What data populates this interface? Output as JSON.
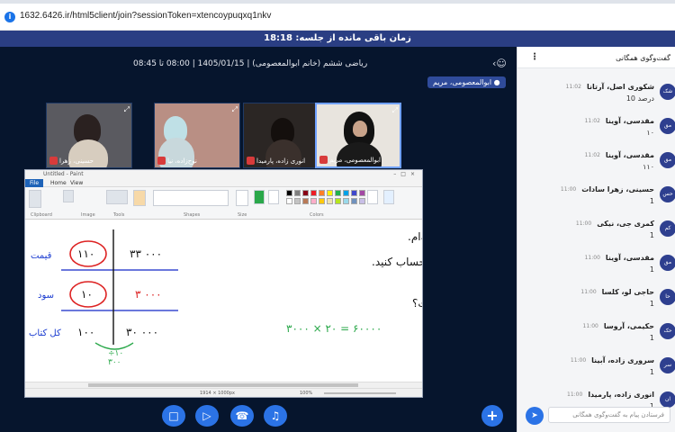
{
  "browser": {
    "url": "1632.6426.ir/html5client/join?sessionToken=xtencoypuqxq1nkv"
  },
  "session": {
    "timer_text": "زمان باقی مانده از جلسه: 18:18"
  },
  "meeting": {
    "title": "ریاضی ششم (خانم ابوالمعصومی) | 1405/01/15 | 08:00 تا 08:45",
    "presenter": "ابوالمعصومی، مریم"
  },
  "videos": [
    {
      "name": "حسینی، زهرا",
      "bg": "#5a5a60",
      "active": false
    },
    {
      "name": "نوح‌زاده، نیا",
      "bg": "#b98f84",
      "active": false
    },
    {
      "name": "انوری زاده، پارمیدا",
      "bg": "#2b2624",
      "active": false
    },
    {
      "name": "ابوالمعصومی، مریم",
      "bg": "#e8e4de",
      "active": true
    }
  ],
  "paint": {
    "window_title": "Untitled - Paint",
    "tabs": [
      "File",
      "Home",
      "View"
    ],
    "ribbon_groups": [
      "Clipboard",
      "Image",
      "Tools",
      "Shapes",
      "Size",
      "Colors"
    ],
    "status_dims": "1914 × 1000px",
    "zoom": "100%",
    "palette": [
      "#000000",
      "#7f7f7f",
      "#880015",
      "#ed1c24",
      "#ff7f27",
      "#fff200",
      "#22b14c",
      "#00a2e8",
      "#3f48cc",
      "#a349a4",
      "#ffffff",
      "#c3c3c3",
      "#b97a57",
      "#ffaec9",
      "#ffc90e",
      "#efe4b0",
      "#b5e61d",
      "#99d9ea",
      "#7092be",
      "#c8bfe7"
    ]
  },
  "board": {
    "problem_line": "۲. کتابی را که ۳۰۰۰ تومان خریداری شده است، ۳۳۰۰ تومان فروخته‌ام.",
    "part_a": "الف) درصد سود این کتاب را حساب کنید.",
    "part_b": "ب) سود ۲۰ عدد کتاب چقدر است؟",
    "answer": "۳۰۰۰ × ۲۰ = ۶۰۰۰۰",
    "label_price": "قیمت",
    "label_profit": "سود",
    "label_total": "کل کتاب",
    "val_110": "۱۱۰",
    "val_10": "۱۰",
    "val_100": "۱۰۰",
    "val_33000": "۳۳ ۰۰۰",
    "val_3000": "۳ ۰۰۰",
    "val_30000": "۳۰ ۰۰۰",
    "val_300": "۳۰۰",
    "div_10": "÷۱۰"
  },
  "chat": {
    "title": "گفت‌وگوی همگانی",
    "input_placeholder": "فرستادن پیام به گفت‌وگوی همگانی",
    "messages": [
      {
        "initials": "شک",
        "name": "شکوری اصل، آرتانا",
        "time": "11:02",
        "text": "10 درصد"
      },
      {
        "initials": "مق",
        "name": "مقدسی، آوینا",
        "time": "11:02",
        "text": "۱۰"
      },
      {
        "initials": "مق",
        "name": "مقدسی، آوینا",
        "time": "11:02",
        "text": "۱۱۰"
      },
      {
        "initials": "حس",
        "name": "حسینی، زهرا سادات",
        "time": "11:00",
        "text": "1"
      },
      {
        "initials": "کم",
        "name": "کمری جی، نیکی",
        "time": "11:00",
        "text": "1"
      },
      {
        "initials": "مق",
        "name": "مقدسی، آوینا",
        "time": "11:00",
        "text": "1"
      },
      {
        "initials": "حا",
        "name": "حاجی لو، کلسا",
        "time": "11:00",
        "text": "1"
      },
      {
        "initials": "حک",
        "name": "حکیمی، آروسا",
        "time": "11:00",
        "text": "1"
      },
      {
        "initials": "سر",
        "name": "سروری زاده، آبینا",
        "time": "11:00",
        "text": "1"
      },
      {
        "initials": "ان",
        "name": "انوری زاده، پارمیدا",
        "time": "11:00",
        "text": "1"
      }
    ]
  },
  "controls": {
    "screen_icon": "screen-share-icon",
    "video_icon": "video-camera-icon",
    "phone_icon": "phone-icon",
    "mic_icon": "microphone-icon",
    "plus_icon": "plus-icon"
  }
}
